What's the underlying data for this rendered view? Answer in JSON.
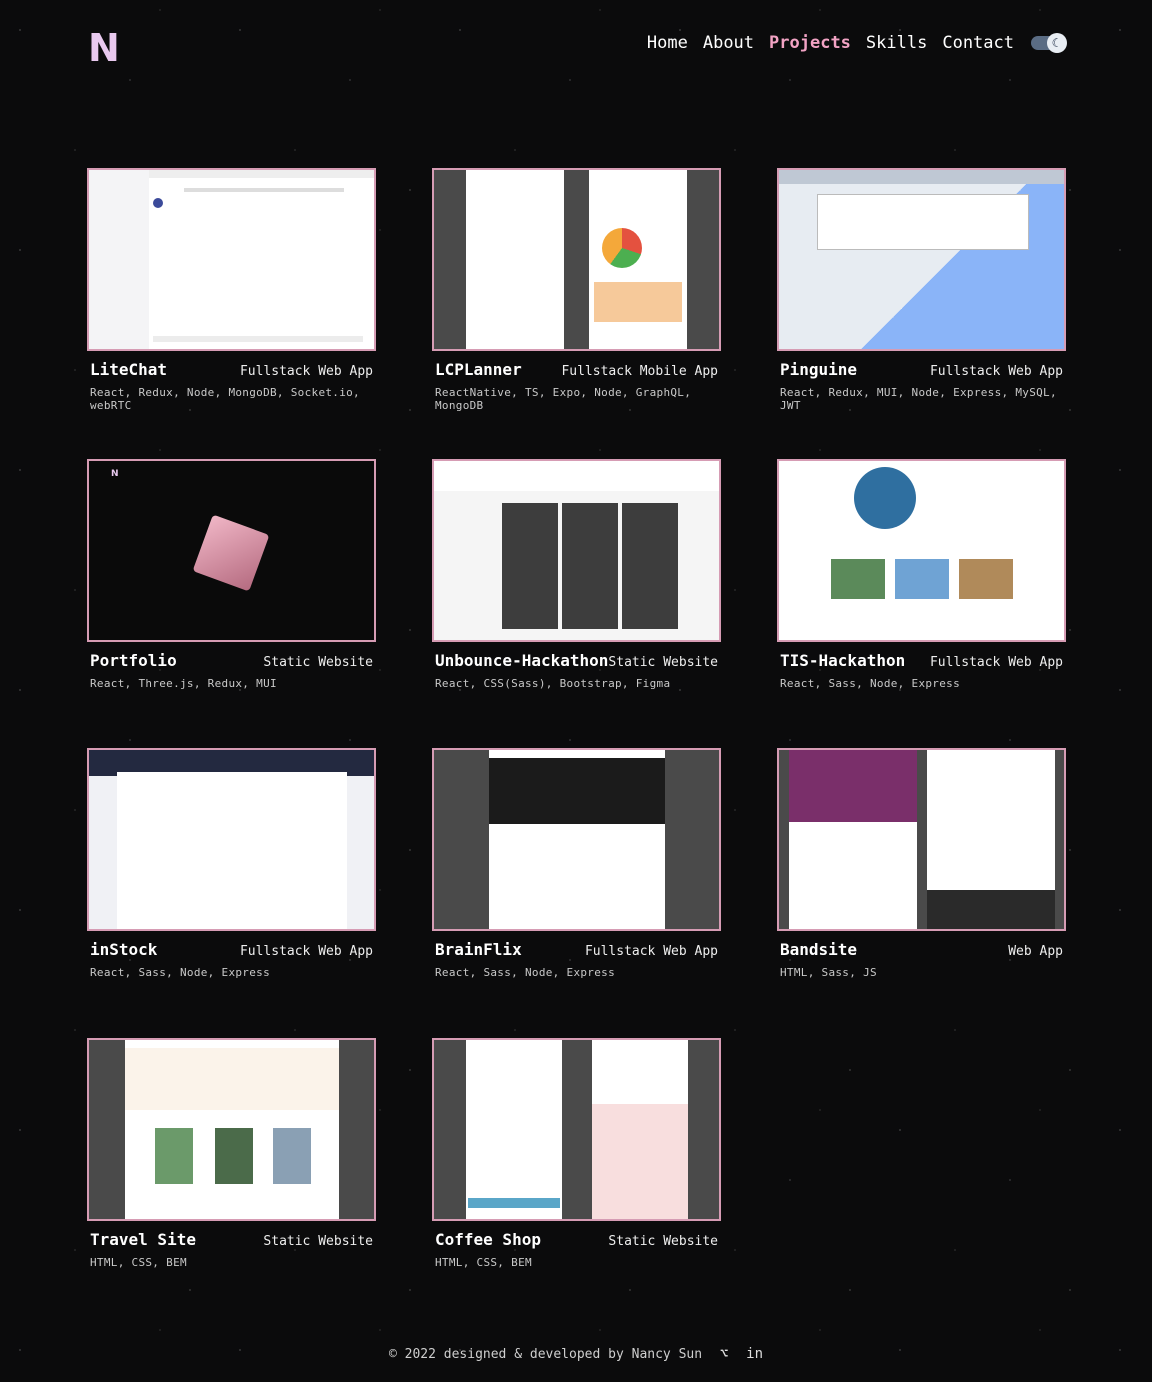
{
  "logo": "N",
  "nav": [
    "Home",
    "About",
    "Projects",
    "Skills",
    "Contact"
  ],
  "active_nav": "Projects",
  "projects": [
    {
      "title": "LiteChat",
      "type": "Fullstack Web App",
      "tech": "React, Redux, Node, MongoDB, Socket.io, webRTC"
    },
    {
      "title": "LCPLanner",
      "type": "Fullstack Mobile App",
      "tech": "ReactNative, TS, Expo, Node, GraphQL, MongoDB"
    },
    {
      "title": "Pinguine",
      "type": "Fullstack Web App",
      "tech": "React, Redux, MUI, Node, Express, MySQL, JWT"
    },
    {
      "title": "Portfolio",
      "type": "Static Website",
      "tech": "React, Three.js, Redux, MUI"
    },
    {
      "title": "Unbounce-Hackathon",
      "type": "Static Website",
      "tech": "React, CSS(Sass), Bootstrap, Figma"
    },
    {
      "title": "TIS-Hackathon",
      "type": "Fullstack Web App",
      "tech": "React, Sass, Node, Express"
    },
    {
      "title": "inStock",
      "type": "Fullstack Web App",
      "tech": "React, Sass, Node, Express"
    },
    {
      "title": "BrainFlix",
      "type": "Fullstack Web App",
      "tech": "React, Sass, Node, Express"
    },
    {
      "title": "Bandsite",
      "type": "Web App",
      "tech": "HTML, Sass, JS"
    },
    {
      "title": "Travel Site",
      "type": "Static Website",
      "tech": "HTML, CSS, BEM"
    },
    {
      "title": "Coffee Shop",
      "type": "Static Website",
      "tech": "HTML, CSS, BEM"
    }
  ],
  "footer": {
    "text": "© 2022 designed & developed by Nancy Sun"
  },
  "icons": {
    "theme_toggle": "moon-icon",
    "github": "github-icon",
    "linkedin": "linkedin-icon"
  }
}
